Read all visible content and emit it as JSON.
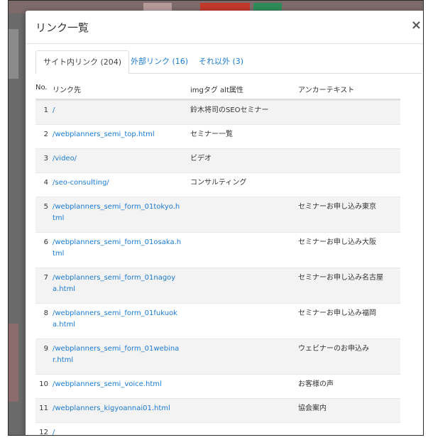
{
  "modal": {
    "title": "リンク一覧",
    "close_label": "×"
  },
  "tabs": [
    {
      "label": "サイト内リンク (204)",
      "active": true
    },
    {
      "label": "外部リンク (16)",
      "active": false
    },
    {
      "label": "それ以外 (3)",
      "active": false
    }
  ],
  "table": {
    "headers": {
      "no": "No.",
      "url": "リンク先",
      "alt": "imgタグ alt属性",
      "anchor": "アンカーテキスト"
    },
    "rows": [
      {
        "no": "1",
        "url": "/",
        "alt": "鈴木将司のSEOセミナー",
        "anchor": ""
      },
      {
        "no": "2",
        "url": "/webplanners_semi_top.html",
        "alt": "セミナー一覧",
        "anchor": ""
      },
      {
        "no": "3",
        "url": "/video/",
        "alt": "ビデオ",
        "anchor": ""
      },
      {
        "no": "4",
        "url": "/seo-consulting/",
        "alt": "コンサルティング",
        "anchor": ""
      },
      {
        "no": "5",
        "url": "/webplanners_semi_form_01tokyo.html",
        "alt": "",
        "anchor": "セミナーお申し込み東京"
      },
      {
        "no": "6",
        "url": "/webplanners_semi_form_01osaka.html",
        "alt": "",
        "anchor": "セミナーお申し込み大阪"
      },
      {
        "no": "7",
        "url": "/webplanners_semi_form_01nagoya.html",
        "alt": "",
        "anchor": "セミナーお申し込み名古屋"
      },
      {
        "no": "8",
        "url": "/webplanners_semi_form_01fukuoka.html",
        "alt": "",
        "anchor": "セミナーお申し込み福岡"
      },
      {
        "no": "9",
        "url": "/webplanners_semi_form_01webinar.html",
        "alt": "",
        "anchor": "ウェビナーのお申込み"
      },
      {
        "no": "10",
        "url": "/webplanners_semi_voice.html",
        "alt": "",
        "anchor": "お客様の声"
      },
      {
        "no": "11",
        "url": "/webplanners_kigyoannai01.html",
        "alt": "",
        "anchor": "協会案内"
      },
      {
        "no": "12",
        "url": "/",
        "alt": "",
        "anchor": ""
      }
    ]
  },
  "colors": {
    "link": "#1a7ad3",
    "stripe": "#f3f3f3",
    "backdrop": "#6a6a6a"
  }
}
